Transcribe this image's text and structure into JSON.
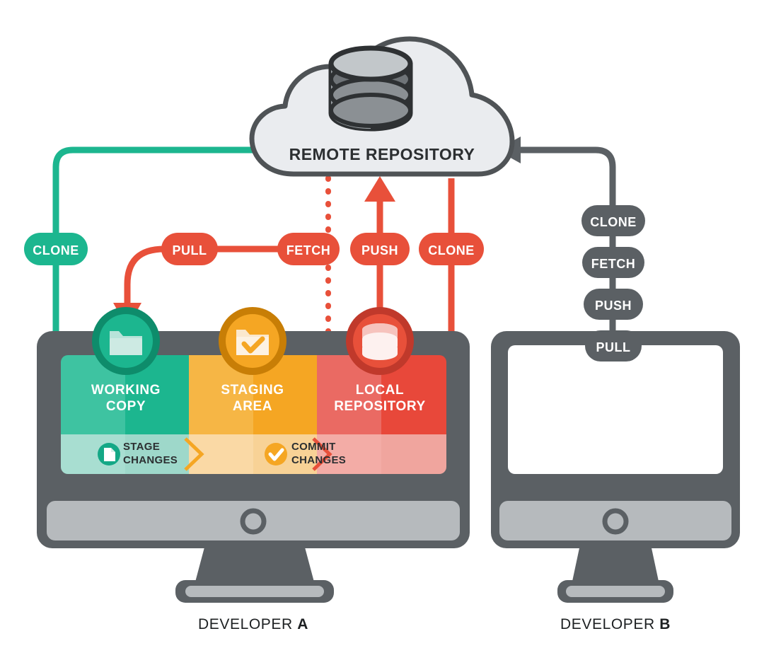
{
  "diagram": {
    "title_text": "REMOTE REPOSITORY",
    "type": "git-workflow-diagram"
  },
  "cloud": {
    "label": "REMOTE REPOSITORY",
    "icon": "database-icon",
    "fill": "#eaecef",
    "stroke": "#4f5356",
    "text_color": "#2c2f31"
  },
  "colors": {
    "teal": "#1cb68f",
    "teal_dark": "#0e8c6b",
    "teal_light": "#3ec3a1",
    "teal_lighter": "#4ecaa9",
    "teal_pale": "#a8ded1",
    "teal_pale_dark": "#9ed8ca",
    "red": "#e8503a",
    "red_dark": "#c0392b",
    "red_light": "#ef6a5a",
    "red_col_left": "#ea6a63",
    "red_col_right": "#e8483a",
    "red_pale": "#f3aca6",
    "red_pale_dark": "#f0a59e",
    "orange": "#f5a623",
    "orange_dark": "#c87e06",
    "orange_light": "#f6b645",
    "orange_pale": "#fad9a5",
    "orange_pale_dark": "#f8d296",
    "gray": "#5b6064",
    "gray_light": "#b9bdc0",
    "gray_chin": "#b6babd",
    "white": "#ffffff",
    "cream": "#fbe8cd"
  },
  "left_flow_pills": [
    {
      "label": "CLONE",
      "color": "teal",
      "name": "pill-clone-left"
    },
    {
      "label": "PULL",
      "color": "red",
      "name": "pill-pull"
    },
    {
      "label": "FETCH",
      "color": "red",
      "name": "pill-fetch"
    },
    {
      "label": "PUSH",
      "color": "red",
      "name": "pill-push"
    },
    {
      "label": "CLONE",
      "color": "red",
      "name": "pill-clone-right"
    }
  ],
  "right_flow_pills": [
    {
      "label": "CLONE",
      "name": "pill-dev-b-clone"
    },
    {
      "label": "FETCH",
      "name": "pill-dev-b-fetch"
    },
    {
      "label": "PUSH",
      "name": "pill-dev-b-push"
    },
    {
      "label": "PULL",
      "name": "pill-dev-b-pull"
    }
  ],
  "columns": [
    {
      "title_line1": "WORKING",
      "title_line2": "COPY",
      "icon": "folder-icon",
      "action_line1": "STAGE",
      "action_line2": "CHANGES",
      "action_icon": "document-icon"
    },
    {
      "title_line1": "STAGING",
      "title_line2": "AREA",
      "icon": "folder-check-icon",
      "action_line1": "COMMIT",
      "action_line2": "CHANGES",
      "action_icon": "check-circle-icon"
    },
    {
      "title_line1": "LOCAL",
      "title_line2": "REPOSITORY",
      "icon": "database-icon",
      "action_line1": "",
      "action_line2": "",
      "action_icon": ""
    }
  ],
  "developers": [
    {
      "prefix": "DEVELOPER ",
      "letter": "A",
      "name": "developer-a-label"
    },
    {
      "prefix": "DEVELOPER ",
      "letter": "B",
      "name": "developer-b-label"
    }
  ]
}
